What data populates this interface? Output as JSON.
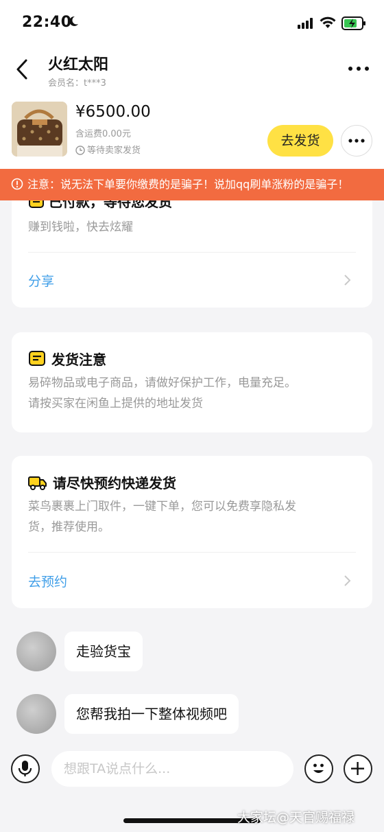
{
  "status_bar": {
    "time": "22:40"
  },
  "header": {
    "title": "火红太阳",
    "member": "会员名：t***3"
  },
  "product": {
    "price": "¥6500.00",
    "shipping": "含运费0.00元",
    "status": "等待卖家发货",
    "ship_button": "去发货"
  },
  "notice": {
    "text": "注意：说无法下单要你缴费的是骗子！说加qq刷单涨粉的是骗子！"
  },
  "card_paid": {
    "title": "已付款，等待您发货",
    "subtitle": "赚到钱啦，快去炫耀",
    "link": "分享"
  },
  "card_notice": {
    "title": "发货注意",
    "line1": "易碎物品或电子商品，请做好保护工作，电量充足。",
    "line2": "请按买家在闲鱼上提供的地址发货"
  },
  "card_express": {
    "title": "请尽快预约快递发货",
    "line1": "菜鸟裹裹上门取件，一键下单，您可以免费享隐私发",
    "line2": "货，推荐使用。",
    "link": "去预约"
  },
  "messages": [
    {
      "text": "走验货宝"
    },
    {
      "text": "您帮我拍一下整体视频吧"
    }
  ],
  "input": {
    "placeholder": "想跟TA说点什么..."
  },
  "watermark": "大家坛@天官赐福禄",
  "colors": {
    "accent_yellow": "#ffe144",
    "notice_orange": "#f26b40",
    "link_blue": "#3f9ee8"
  }
}
